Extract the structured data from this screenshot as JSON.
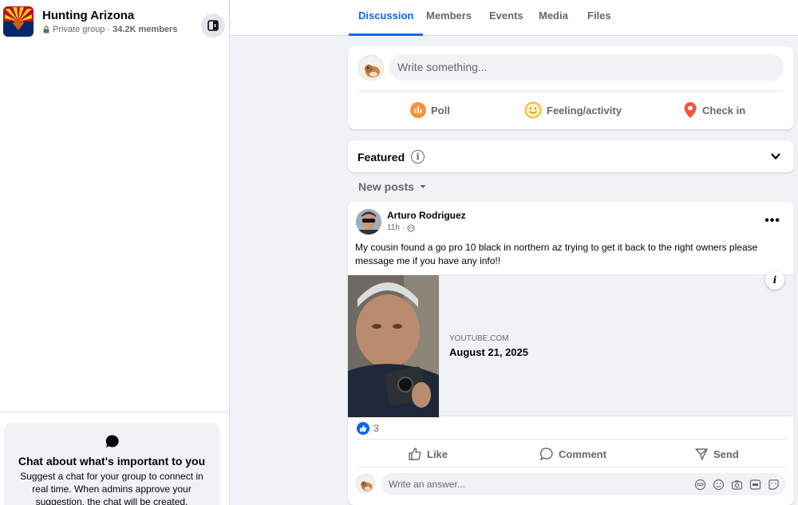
{
  "group": {
    "name": "Hunting Arizona",
    "privacy": "Private group",
    "separator": "·",
    "members": "34.2K members"
  },
  "tabs": [
    {
      "label": "Discussion",
      "active": true
    },
    {
      "label": "Members",
      "active": false
    },
    {
      "label": "Events",
      "active": false
    },
    {
      "label": "Media",
      "active": false
    },
    {
      "label": "Files",
      "active": false
    }
  ],
  "composer": {
    "placeholder": "Write something...",
    "actions": [
      {
        "label": "Poll",
        "icon": "poll-icon",
        "color": "#f7923b"
      },
      {
        "label": "Feeling/activity",
        "icon": "smiley-icon",
        "color": "#f7b928"
      },
      {
        "label": "Check in",
        "icon": "location-pin-icon",
        "color": "#f5533d"
      }
    ]
  },
  "featured": {
    "label": "Featured",
    "info_glyph": "i"
  },
  "feed": {
    "sort_label": "New posts"
  },
  "post": {
    "author": "Arturo Rodriguez",
    "time": "11h",
    "time_separator": "·",
    "more": "•••",
    "text": "My cousin found a go pro 10 black in northern az trying to get it back to the right owners please message me if you have any info!!",
    "link": {
      "domain": "YOUTUBE.COM",
      "title": "August 21, 2025",
      "info_glyph": "i"
    },
    "reaction_count": "3",
    "actions": {
      "like": "Like",
      "comment": "Comment",
      "send": "Send"
    },
    "answer_placeholder": "Write an answer..."
  },
  "chat": {
    "title": "Chat about what's important to you",
    "description": "Suggest a chat for your group to connect in real time. When admins approve your suggestion, the chat will be created."
  },
  "colors": {
    "accent": "#0866ff",
    "secondary_text": "#65676b",
    "page_bg": "#f0f2f5"
  }
}
